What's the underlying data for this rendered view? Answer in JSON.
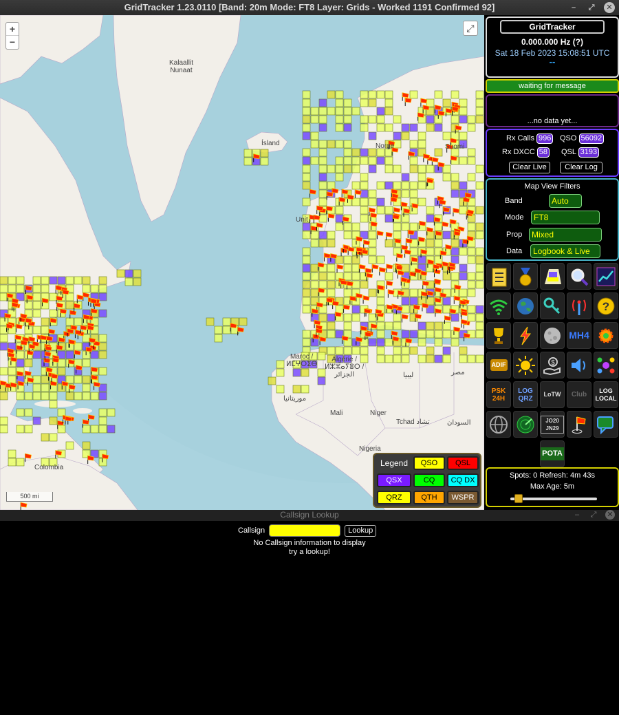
{
  "window": {
    "title": "GridTracker 1.23.0110 [Band: 20m Mode: FT8 Layer: Grids - Worked 1191 Confirmed 92]",
    "controls": [
      "–",
      "⤢",
      "✕"
    ]
  },
  "map": {
    "zoom_in": "+",
    "zoom_out": "−",
    "fullscreen": "⤢",
    "scale": "500 mi",
    "labels": {
      "greenland_line1": "Kalaallit",
      "greenland_line2": "Nunaat",
      "iceland": "Ísland",
      "norway": "Norge",
      "finland": "Suomi",
      "uk": "Unit",
      "morocco_line1": "Maroc /",
      "morocco_line2": "ⵍⵎⵖⵔⵉⴱ",
      "algeria_line1": "Algérie /",
      "algeria_line2": "ⵍⵣⵣⴰⵢⴻⵔ /",
      "algeria_line3": "الجزائر",
      "libya": "ليبيا",
      "egypt": "مصر",
      "mauritania": "موريتانيا",
      "mali": "Mali",
      "niger": "Niger",
      "chad": "Tchad تشاد",
      "sudan": "السودان",
      "nigeria": "Nigeria",
      "colombia": "Colombia"
    }
  },
  "legend": {
    "title": "Legend",
    "items": [
      {
        "label": "QSO",
        "bg": "#ffff00",
        "fg": "#000000"
      },
      {
        "label": "QSL",
        "bg": "#ff0000",
        "fg": "#000000"
      },
      {
        "label": "QSX",
        "bg": "#7a1bff",
        "fg": "#ffffff"
      },
      {
        "label": "CQ",
        "bg": "#00ff00",
        "fg": "#000000"
      },
      {
        "label": "CQ DX",
        "bg": "#00ffff",
        "fg": "#000000"
      },
      {
        "label": "QRZ",
        "bg": "#ffff00",
        "fg": "#000000"
      },
      {
        "label": "QTH",
        "bg": "#ffa500",
        "fg": "#000000"
      },
      {
        "label": "WSPR",
        "bg": "#7b5a32",
        "fg": "#ffffff"
      }
    ]
  },
  "status": {
    "app_button": "GridTracker",
    "frequency": "0.000.000 Hz (?)",
    "datetime": "Sat 18 Feb 2023 15:08:51 UTC",
    "dashes": "--",
    "message": "waiting for message",
    "no_data": "...no data yet..."
  },
  "stats": {
    "rx_calls_label": "Rx Calls",
    "rx_calls": "996",
    "qso_label": "QSO",
    "qso": "56092",
    "rx_dxcc_label": "Rx DXCC",
    "rx_dxcc": "58",
    "qsl_label": "QSL",
    "qsl": "3193",
    "clear_live": "Clear Live",
    "clear_log": "Clear Log"
  },
  "filters": {
    "title": "Map View Filters",
    "band_label": "Band",
    "band": "Auto",
    "mode_label": "Mode",
    "mode": "FT8",
    "prop_label": "Prop",
    "prop": "Mixed",
    "data_label": "Data",
    "data": "Logbook & Live"
  },
  "icons": [
    {
      "name": "checklist",
      "text": ""
    },
    {
      "name": "medal",
      "text": ""
    },
    {
      "name": "map-roll",
      "text": ""
    },
    {
      "name": "magnifier",
      "text": ""
    },
    {
      "name": "chart-trend",
      "text": ""
    },
    {
      "name": "wifi",
      "text": ""
    },
    {
      "name": "globe",
      "text": ""
    },
    {
      "name": "key",
      "text": ""
    },
    {
      "name": "radio-tower",
      "text": ""
    },
    {
      "name": "help",
      "text": ""
    },
    {
      "name": "trophy",
      "text": ""
    },
    {
      "name": "lightning",
      "text": ""
    },
    {
      "name": "moon",
      "text": ""
    },
    {
      "name": "maidenhead",
      "text": "MH4"
    },
    {
      "name": "settings",
      "text": ""
    },
    {
      "name": "adif",
      "text": "ADIF"
    },
    {
      "name": "sun",
      "text": ""
    },
    {
      "name": "donate",
      "text": ""
    },
    {
      "name": "speaker",
      "text": ""
    },
    {
      "name": "network",
      "text": ""
    },
    {
      "name": "psk-reporter",
      "text": "PSK 24H"
    },
    {
      "name": "log-qrz",
      "text": "LOG QRZ"
    },
    {
      "name": "lotw",
      "text": "LoTW"
    },
    {
      "name": "club-log",
      "text": "Club"
    },
    {
      "name": "log-local",
      "text": "LOG LOCAL"
    },
    {
      "name": "world-time",
      "text": ""
    },
    {
      "name": "radar",
      "text": ""
    },
    {
      "name": "grid-squares",
      "text": "JO20 JN29"
    },
    {
      "name": "flag-pin",
      "text": ""
    },
    {
      "name": "chat",
      "text": ""
    },
    {
      "name": "pota",
      "text": "POTA"
    }
  ],
  "spots": {
    "line1": "Spots: 0 Refresh: 4m 43s",
    "line2": "Max Age: 5m",
    "max_age_fraction": 0.05
  },
  "lookup": {
    "window_title": "Callsign Lookup",
    "callsign_label": "Callsign",
    "callsign_value": "",
    "button": "Lookup",
    "message_line1": "No Callsign information to display",
    "message_line2": "try a lookup!"
  }
}
